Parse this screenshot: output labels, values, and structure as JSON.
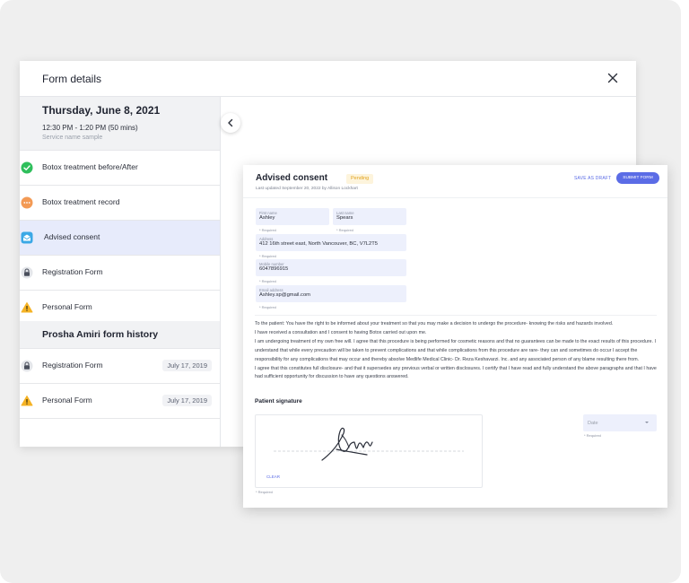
{
  "panel": {
    "title": "Form details",
    "date_heading": "Thursday, June 8, 2021",
    "time_range": "12:30 PM - 1:20 PM (50 mins)",
    "service_name": "Service name sample",
    "forms": [
      {
        "label": "Botox treatment before/After",
        "icon": "check-circle-icon",
        "color": "#2fbf5c"
      },
      {
        "label": "Botox treatment record",
        "icon": "dots-circle-icon",
        "color": "#f39a55"
      },
      {
        "label": "Advised consent",
        "icon": "envelope-open-icon",
        "color": "#3ba8e6"
      },
      {
        "label": "Registration Form",
        "icon": "lock-icon",
        "color": "#4a4f5c"
      },
      {
        "label": "Personal Form",
        "icon": "warning-icon",
        "color": "#f5b325"
      }
    ],
    "history_title": "Prosha Amiri form history",
    "history": [
      {
        "label": "Registration Form",
        "date": "July 17, 2019",
        "icon": "lock-icon"
      },
      {
        "label": "Personal Form",
        "date": "July 17, 2019",
        "icon": "warning-icon"
      }
    ]
  },
  "consent_form": {
    "title": "Advised consent",
    "status": "Pending",
    "updated": "Last updated September 20, 2022 by Allison Lockhart",
    "save_draft": "SAVE AS DRAFT",
    "submit": "SUBMIT FORM",
    "fields": {
      "first_name": {
        "label": "First name",
        "value": "Ashley"
      },
      "last_name": {
        "label": "Last name",
        "value": "Spears"
      },
      "address": {
        "label": "Address",
        "value": "412 16th street east, North Vancouver, BC, V7L2T5"
      },
      "mobile": {
        "label": "Mobile number",
        "value": "6047896915"
      },
      "email": {
        "label": "Email address",
        "value": "Ashley.sp@gmail.com"
      }
    },
    "required": "* Required",
    "consent_paragraphs": [
      "To the patient: You have the right to be informed about your treatment so that you may make a decision to undergo the procedure- knowing the risks and hazards involved.",
      "I have received a consultation and I consent to having Botox carried out upon me.",
      "I am undergoing treatment of my own free will. I agree that this procedure is being performed for cosmetic reasons and that no guarantees can be made to the exact results of this procedure. I understand that while every precaution will be taken to prevent complications and that while complications from this procedure are rare- they can and sometimes do occur I accept the responsibility for any complications that may occur and thereby absolve Medlife Medical Clinic- Dr. Reza Keshavarzi. Inc. and any associated person of any blame resulting there from.",
      "I agree that this constitutes full disclosure- and that it supersedes any previous verbal or written disclosures. I certify that I have read and fully understand the above paragraphs and that I have had sufficient opportunity for discussion to have any questions answered."
    ],
    "signature_title": "Patient signature",
    "clear": "CLEAR",
    "date_placeholder": "Date"
  }
}
